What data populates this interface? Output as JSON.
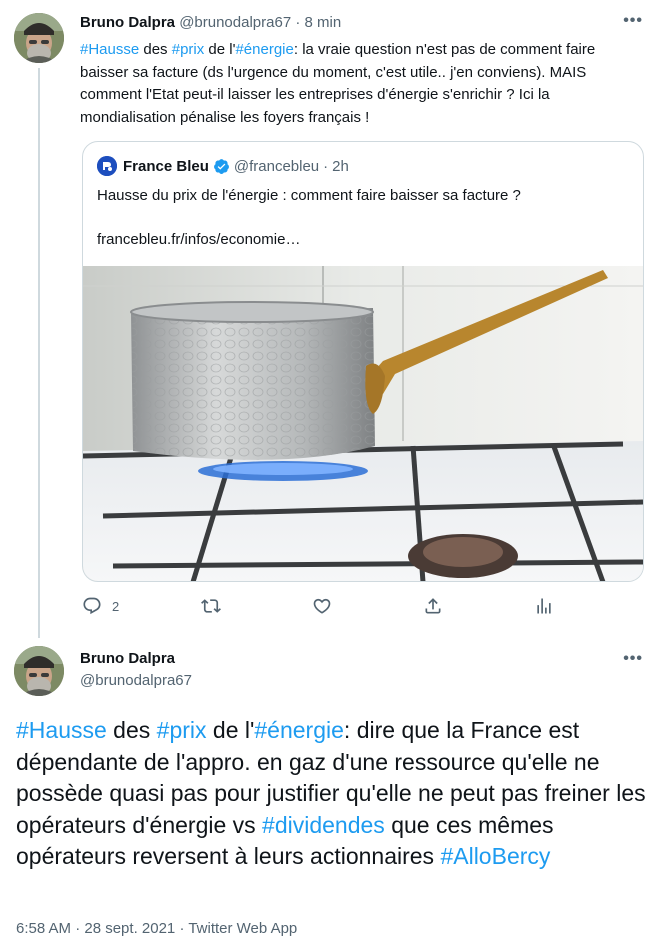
{
  "tweet1": {
    "author_name": "Bruno Dalpra",
    "author_handle": "@brunodalpra67",
    "separator": "·",
    "time": "8 min",
    "more": "•••",
    "text_parts": {
      "h1": "#Hausse",
      "t1": " des ",
      "h2": "#prix",
      "t2": " de l'",
      "h3": "#énergie",
      "t3": ": la vraie question n'est pas de comment faire baisser sa facture (ds l'urgence du moment, c'est utile.. j'en conviens). MAIS comment l'Etat peut-il laisser les entreprises d'énergie s'enrichir ? Ici la mondialisation pénalise les foyers français !"
    },
    "quote": {
      "author_name": "France Bleu",
      "author_handle": "@francebleu",
      "separator": "·",
      "time": "2h",
      "text": "Hausse du prix de l'énergie : comment faire baisser sa facture ?",
      "link": "francebleu.fr/infos/economie…"
    },
    "actions": {
      "reply_count": "2"
    }
  },
  "tweet2": {
    "author_name": "Bruno Dalpra",
    "author_handle": "@brunodalpra67",
    "more": "•••",
    "text_parts": {
      "h1": "#Hausse",
      "t1": " des ",
      "h2": "#prix",
      "t2": " de l'",
      "h3": "#énergie",
      "t3": ": dire que la France est dépendante de l'appro. en gaz d'une ressource qu'elle ne possède quasi pas pour justifier qu'elle ne peut pas freiner les opérateurs d'énergie vs ",
      "h4": "#dividendes",
      "t4": " que ces mêmes opérateurs reversent à leurs actionnaires ",
      "h5": "#AlloBercy"
    },
    "meta": "6:58 AM · 28 sept. 2021 · Twitter Web App"
  },
  "colors": {
    "accent": "#1d9bf0",
    "muted": "#536471",
    "border": "#cfd9de",
    "text": "#0f1419"
  }
}
